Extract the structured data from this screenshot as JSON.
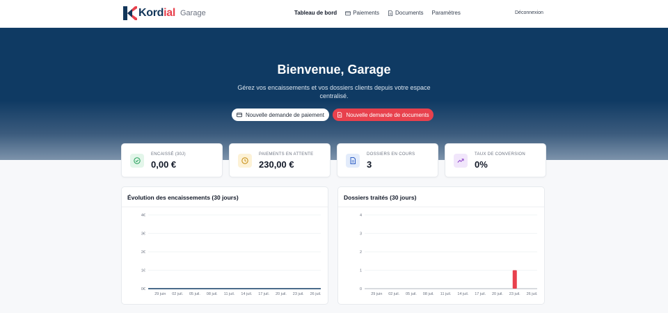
{
  "nav": {
    "logo_main": "Kord",
    "logo_accent": "ial",
    "space": "Garage",
    "links": [
      "Tableau de bord",
      "Paiements",
      "Documents",
      "Paramètres"
    ],
    "logout": "Déconnexion"
  },
  "hero": {
    "title": "Bienvenue, Garage",
    "subtitle": "Gérez vos encaissements et vos dossiers clients depuis votre espace centralisé.",
    "btn_payment": "Nouvelle demande de paiement",
    "btn_documents": "Nouvelle demande de documents"
  },
  "stats": [
    {
      "label": "Encaissé (30j)",
      "value": "0,00 €",
      "icon": "check-circle-icon",
      "bg": "#e3f6ea",
      "color": "#1f9d55"
    },
    {
      "label": "Paiements en attente",
      "value": "230,00 €",
      "icon": "clock-icon",
      "bg": "#fdf2d6",
      "color": "#c58a0c"
    },
    {
      "label": "Dossiers en cours",
      "value": "3",
      "icon": "document-icon",
      "bg": "#e3ecfb",
      "color": "#2f5fc4"
    },
    {
      "label": "Taux de conversion",
      "value": "0%",
      "icon": "trending-up-icon",
      "bg": "#f1e6fb",
      "color": "#8a3fc7"
    }
  ],
  "colors": {
    "primary": "#0f3a63",
    "accent": "#e8414d"
  },
  "chart_data": [
    {
      "type": "line",
      "title": "Évolution des encaissements (30 jours)",
      "x": [
        "29 juin",
        "02 juil.",
        "05 juil.",
        "08 juil.",
        "11 juil.",
        "14 juil.",
        "17 juil.",
        "20 juil.",
        "23 juil.",
        "26 juil."
      ],
      "y_ticks": [
        "0€",
        "1€",
        "2€",
        "3€",
        "4€"
      ],
      "ylim": [
        0,
        4
      ],
      "values": [
        0,
        0,
        0,
        0,
        0,
        0,
        0,
        0,
        0,
        0,
        0
      ],
      "color": "#0f3a63"
    },
    {
      "type": "bar",
      "title": "Dossiers traités (30 jours)",
      "x": [
        "29 juin",
        "02 juil.",
        "05 juil.",
        "08 juil.",
        "11 juil.",
        "14 juil.",
        "17 juil.",
        "20 juil.",
        "23 juil.",
        "26 juil."
      ],
      "y_ticks": [
        "0",
        "1",
        "2",
        "3",
        "4"
      ],
      "ylim": [
        0,
        4
      ],
      "bars": [
        {
          "x": "23 juil.",
          "value": 1
        }
      ],
      "color": "#e8414d"
    }
  ]
}
